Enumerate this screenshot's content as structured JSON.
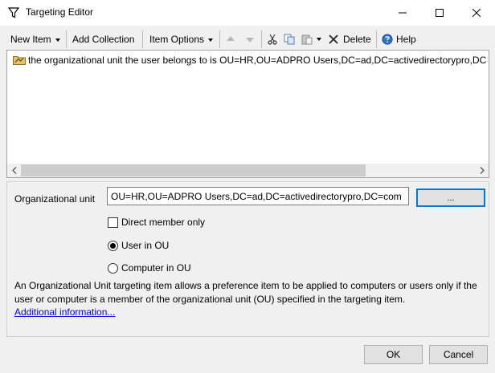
{
  "window": {
    "title": "Targeting Editor",
    "icons": {
      "app": "filter-icon",
      "minimize": "minimize-icon",
      "maximize": "maximize-icon",
      "close": "close-icon"
    }
  },
  "toolbar": {
    "new_item": "New Item",
    "add_collection": "Add Collection",
    "item_options": "Item Options",
    "delete": "Delete",
    "help": "Help",
    "icons": [
      "move-up-icon",
      "move-down-icon",
      "cut-icon",
      "copy-icon",
      "paste-icon",
      "delete-icon",
      "help-icon"
    ]
  },
  "tree": {
    "items": [
      {
        "icon": "folder-icon",
        "label": "the organizational unit the user belongs to is OU=HR,OU=ADPRO Users,DC=ad,DC=activedirectorypro,DC=com"
      }
    ],
    "horizontal_scroll_fraction": 0.76
  },
  "detail": {
    "ou_label": "Organizational unit",
    "ou_value": "OU=HR,OU=ADPRO Users,DC=ad,DC=activedirectorypro,DC=com",
    "browse_label": "...",
    "direct_member_label": "Direct member only",
    "direct_member_checked": false,
    "user_in_ou_label": "User in OU",
    "computer_in_ou_label": "Computer in OU",
    "selected_scope": "User in OU",
    "description": "An Organizational Unit targeting item allows a preference item to be applied to computers or users only if the user or computer is a member of the organizational unit (OU) specified in the targeting item.",
    "link_text": "Additional information..."
  },
  "buttons": {
    "ok": "OK",
    "cancel": "Cancel"
  },
  "colors": {
    "accent": "#0078d7",
    "link": "#0000ee",
    "folder": "#e8c25a"
  }
}
